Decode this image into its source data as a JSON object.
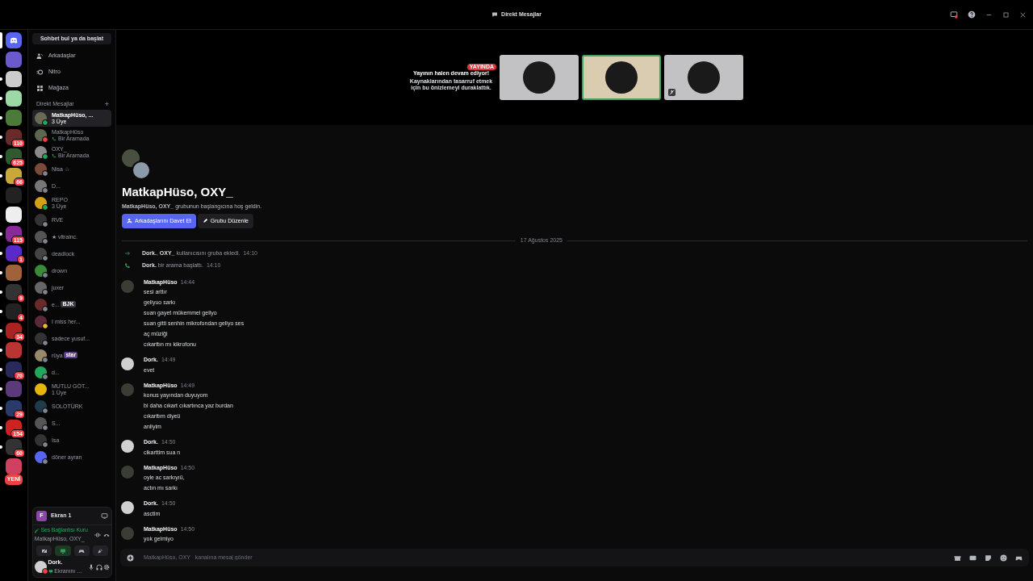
{
  "window": {
    "title": "Direkt Mesajlar"
  },
  "servers": [
    {
      "kind": "home",
      "selected": true,
      "unread": false
    },
    {
      "kind": "server",
      "selected": false,
      "unread": false
    },
    {
      "kind": "server",
      "selected": false,
      "unread": true
    },
    {
      "kind": "server",
      "selected": false,
      "unread": true
    },
    {
      "kind": "server",
      "selected": false,
      "unread": true
    },
    {
      "kind": "server",
      "selected": false,
      "unread": true,
      "badge": "110"
    },
    {
      "kind": "server",
      "selected": false,
      "unread": true,
      "badge": "625"
    },
    {
      "kind": "server",
      "selected": false,
      "unread": true,
      "badge": "66"
    },
    {
      "kind": "server",
      "selected": false,
      "unread": false
    },
    {
      "kind": "server",
      "selected": false,
      "unread": false
    },
    {
      "kind": "server",
      "selected": false,
      "unread": true,
      "badge": "115"
    },
    {
      "kind": "server",
      "selected": false,
      "unread": true,
      "badge": "1"
    },
    {
      "kind": "server",
      "selected": false,
      "unread": true
    },
    {
      "kind": "server",
      "selected": false,
      "unread": true,
      "badge": "9"
    },
    {
      "kind": "server",
      "selected": false,
      "unread": true,
      "badge": "4"
    },
    {
      "kind": "server",
      "selected": false,
      "unread": true,
      "badge": "34"
    },
    {
      "kind": "server",
      "selected": false,
      "unread": true
    },
    {
      "kind": "server",
      "selected": false,
      "unread": true,
      "badge": "70"
    },
    {
      "kind": "server",
      "selected": false,
      "unread": true
    },
    {
      "kind": "server",
      "selected": false,
      "unread": true,
      "badge": "29"
    },
    {
      "kind": "server",
      "selected": false,
      "unread": true,
      "badge": "154"
    },
    {
      "kind": "server",
      "selected": false,
      "unread": true,
      "badge": "60"
    },
    {
      "kind": "server",
      "selected": false,
      "unread": false
    }
  ],
  "servers_new_label": "YENİ",
  "sidebar": {
    "search_button": "Sohbet bul ya da başlat",
    "nav": [
      {
        "kind": "friends",
        "label": "Arkadaşlar"
      },
      {
        "kind": "nitro",
        "label": "Nitro"
      },
      {
        "kind": "shop",
        "label": "Mağaza"
      }
    ],
    "dm_header": "Direkt Mesajlar",
    "add_button": "+",
    "dms": [
      {
        "name": "MatkapHüso, ...",
        "subtitle": "3 Üye",
        "in_call": false,
        "color": "#23a55a",
        "selected": true
      },
      {
        "name": "MatkapHüso",
        "subtitle": "Bir Aramada",
        "in_call": true,
        "color": "#f23f43",
        "selected": false
      },
      {
        "name": "OXY_",
        "subtitle": "Bir Aramada",
        "in_call": true,
        "color": "#23a55a",
        "selected": false
      },
      {
        "name": "Nisa ☆",
        "in_call": false,
        "color": "#80848e",
        "selected": false
      },
      {
        "name": "D...",
        "in_call": false,
        "color": "#80848e",
        "selected": false
      },
      {
        "name": "REPO",
        "subtitle": "3 Üye",
        "in_call": false,
        "color": "#23a55a",
        "selected": false
      },
      {
        "name": "RVE",
        "in_call": false,
        "color": "#80848e",
        "selected": false
      },
      {
        "name": "★ vitrainc.",
        "in_call": false,
        "color": "#80848e",
        "selected": false
      },
      {
        "name": "deadlock",
        "in_call": false,
        "color": "#80848e",
        "selected": false
      },
      {
        "name": "drown",
        "in_call": false,
        "color": "#80848e",
        "selected": false
      },
      {
        "name": "juxer",
        "in_call": false,
        "color": "#80848e",
        "selected": false
      },
      {
        "name": "e...",
        "in_call": false,
        "color": "#80848e",
        "selected": false,
        "tag": {
          "label": "BJK",
          "color": "#3a3a42"
        }
      },
      {
        "name": "I miss her...",
        "in_call": false,
        "color": "#f0b232",
        "selected": false
      },
      {
        "name": "sadece yusuf...",
        "in_call": false,
        "color": "#80848e",
        "selected": false
      },
      {
        "name": "rüya",
        "in_call": false,
        "color": "#80848e",
        "selected": false,
        "tag": {
          "label": "star",
          "color": "#5b3f8c"
        }
      },
      {
        "name": "d...",
        "in_call": false,
        "color": "#80848e",
        "selected": false
      },
      {
        "name": "MUTLU GÖT...",
        "subtitle": "1 Üye",
        "in_call": false,
        "selected": false
      },
      {
        "name": "SOLOTÜRK",
        "in_call": false,
        "color": "#80848e",
        "selected": false
      },
      {
        "name": "S...",
        "in_call": false,
        "color": "#80848e",
        "selected": false
      },
      {
        "name": "İsa",
        "in_call": false,
        "color": "#80848e",
        "selected": false
      },
      {
        "name": "döner ayran",
        "in_call": false,
        "color": "#80848e",
        "selected": false
      }
    ]
  },
  "stream_panel": {
    "name": "Ekran 1",
    "avatar_letter": "F"
  },
  "voice": {
    "status": "Ses Bağlantısı Kuru",
    "channel": "MatkapHüso, OXY_",
    "buttons": [
      {
        "kind": "camera-off",
        "selected": false
      },
      {
        "kind": "screen",
        "selected": true
      },
      {
        "kind": "activity",
        "selected": false
      },
      {
        "kind": "soundboard",
        "selected": false
      }
    ]
  },
  "user": {
    "name": "Dork.",
    "status_text": "Ekranını ...",
    "color": "#f23f43"
  },
  "stream_previews": {
    "badge": "YAYINDA",
    "title": "Yayının halen devam ediyor!",
    "description": "Kaynaklarından tasarruf etmek için bu önizlemeyi duraklattık.",
    "tiles": [
      {
        "selected": false,
        "muted": false
      },
      {
        "selected": true,
        "muted": false
      },
      {
        "selected": false,
        "muted": true
      }
    ]
  },
  "channel_header": {
    "title": "MatkapHüso, OXY_",
    "welcome": "**MatkapHüso, OXY_** grubunun başlangıcına hoş geldin.",
    "buttons": [
      {
        "kind": "invite",
        "label": "Arkadaşlarını Davet Et"
      },
      {
        "kind": "edit",
        "label": "Grubu Düzenle"
      }
    ]
  },
  "date_divider": "17 Ağustos 2025",
  "system_messages": [
    {
      "kind": "join",
      "text": "**Dork.**, **OXY_** kullanıcısını gruba ekledi.",
      "time": "14:10"
    },
    {
      "kind": "call",
      "text": "**Dork.** bir arama başlattı.",
      "time": "14:10"
    }
  ],
  "messages": [
    {
      "author": "MatkapHüso",
      "time": "14:44",
      "lines": [
        "sesi arttır",
        "geliyuo sarkı",
        "suan gayet mükemmel geliyo",
        "suan gitti senhin mikrofondan geliyo ses",
        "aç müziği",
        "cıkarttın mı kikrofonu"
      ]
    },
    {
      "author": "Dork.",
      "time": "14:49",
      "lines": [
        "evet"
      ]
    },
    {
      "author": "MatkapHüso",
      "time": "14:49",
      "lines": [
        "konus yayından duyuyom",
        "bi daha cıkart cıkartınca yaz burdan",
        "cıkarttım diyeü",
        "anliyim"
      ]
    },
    {
      "author": "Dork.",
      "time": "14:50",
      "lines": [
        "cikarttim sua n"
      ]
    },
    {
      "author": "MatkapHüso",
      "time": "14:50",
      "lines": [
        "oyle ac sarkıyıü,",
        "actın mı sarkı"
      ]
    },
    {
      "author": "Dork.",
      "time": "14:50",
      "lines": [
        "asctim"
      ]
    },
    {
      "author": "MatkapHüso",
      "time": "14:50",
      "lines": [
        "yok gelmiyo"
      ]
    }
  ],
  "composer": {
    "placeholder": "MatkapHüso, OXY_ kanalına mesaj gönder"
  }
}
